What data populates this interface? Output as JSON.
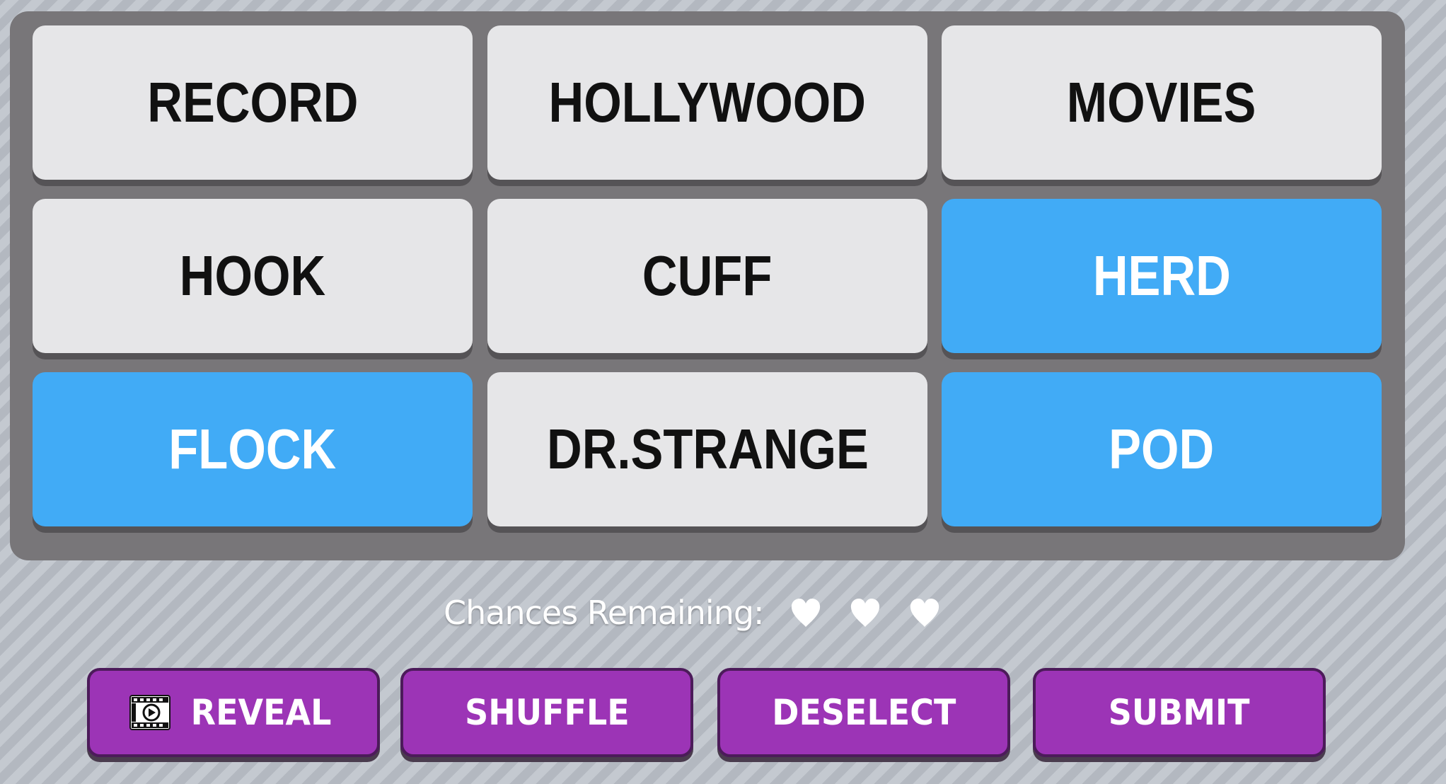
{
  "board": {
    "tiles": [
      {
        "word": "RECORD",
        "selected": false
      },
      {
        "word": "HOLLYWOOD",
        "selected": false
      },
      {
        "word": "MOVIES",
        "selected": false
      },
      {
        "word": "HOOK",
        "selected": false
      },
      {
        "word": "CUFF",
        "selected": false
      },
      {
        "word": "HERD",
        "selected": true
      },
      {
        "word": "FLOCK",
        "selected": true
      },
      {
        "word": "DR.STRANGE",
        "selected": false
      },
      {
        "word": "POD",
        "selected": true
      }
    ]
  },
  "status": {
    "chances_label": "Chances Remaining:",
    "chances_remaining": 3
  },
  "buttons": {
    "reveal": "REVEAL",
    "shuffle": "SHUFFLE",
    "deselect": "DESELECT",
    "submit": "SUBMIT"
  },
  "icons": {
    "heart": "heart-icon",
    "reveal": "film-play-icon"
  },
  "colors": {
    "board": "#787679",
    "tile": "#e6e6e8",
    "tile_selected": "#41abf6",
    "button": "#9c34b6",
    "button_border": "#4c1b5a"
  }
}
